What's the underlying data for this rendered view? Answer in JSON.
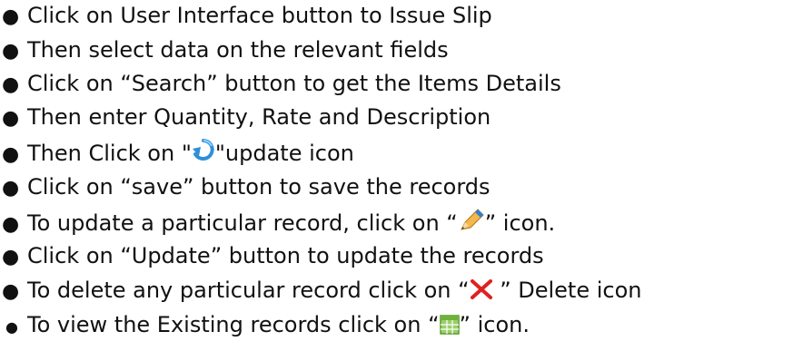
{
  "instructions": {
    "items": [
      {
        "text": "Click on User Interface button to Issue Slip"
      },
      {
        "text": "Then select data on the relevant fields"
      },
      {
        "text": "Click on “Search” button to get the Items Details"
      },
      {
        "text": "Then enter Quantity, Rate and Description"
      },
      {
        "before": "Then Click on \"",
        "icon": "refresh-update-icon",
        "after": "\"update icon"
      },
      {
        "text": "Click on “save” button to save the records"
      },
      {
        "before": "To update a particular record, click on “",
        "icon": "pencil-edit-icon",
        "after": "” icon."
      },
      {
        "text": "Click on “Update” button to update the records"
      },
      {
        "before": "To delete any particular record click on “",
        "icon": "red-x-delete-icon",
        "after": " ” Delete icon"
      },
      {
        "before": "To view the Existing records click on “",
        "icon": "green-grid-view-icon",
        "after": "” icon."
      }
    ]
  }
}
